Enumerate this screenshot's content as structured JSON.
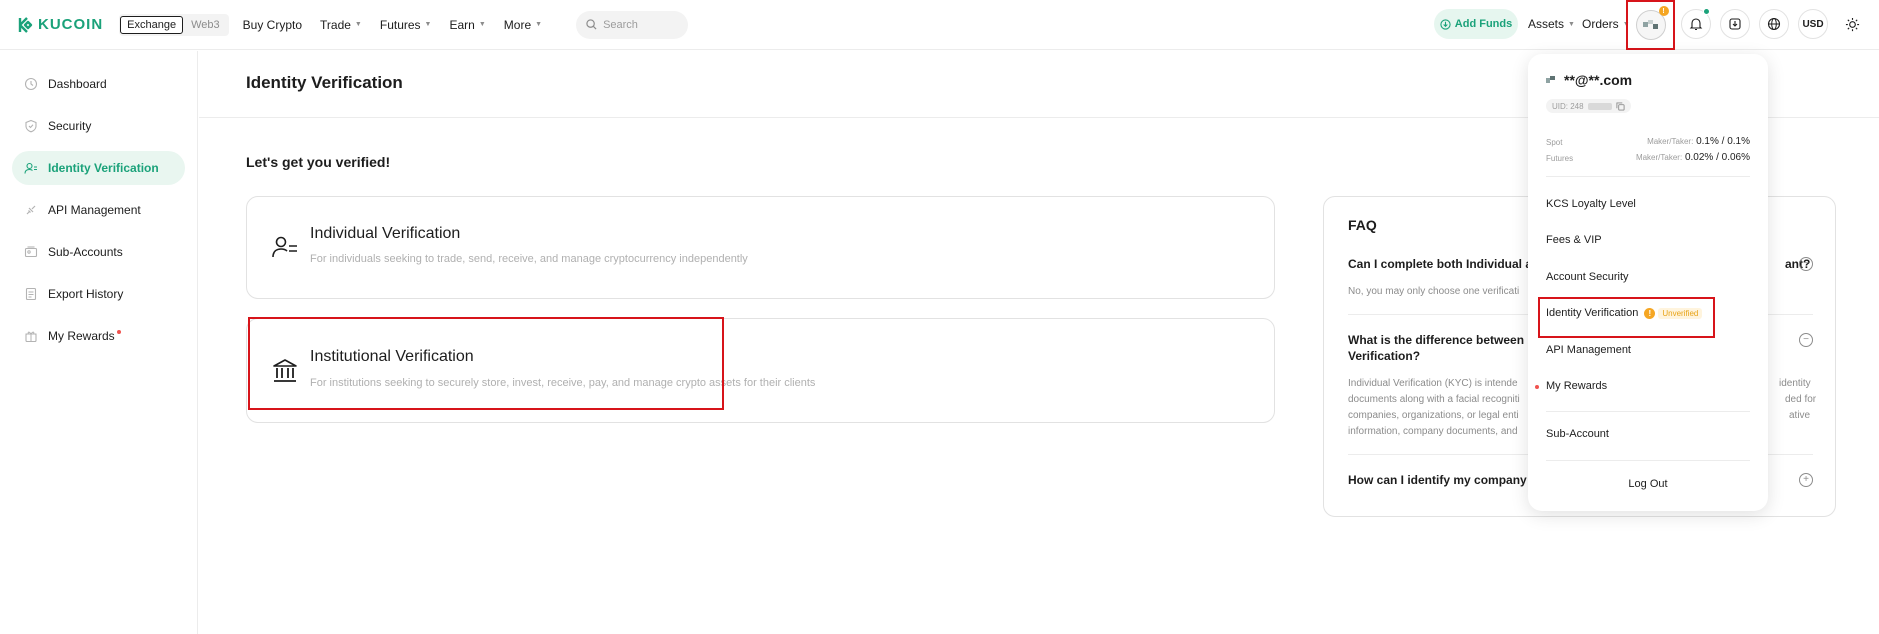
{
  "brand": {
    "name": "KUCOIN",
    "color": "#1ba27a"
  },
  "topbar": {
    "switch": {
      "exchange": "Exchange",
      "web3": "Web3"
    },
    "nav": [
      {
        "label": "Buy Crypto",
        "has_caret": false
      },
      {
        "label": "Trade",
        "has_caret": true
      },
      {
        "label": "Futures",
        "has_caret": true
      },
      {
        "label": "Earn",
        "has_caret": true
      },
      {
        "label": "More",
        "has_caret": true
      }
    ],
    "search_placeholder": "Search",
    "add_funds": "Add Funds",
    "assets": "Assets",
    "orders": "Orders",
    "avatar_badge": "!",
    "currency": "USD"
  },
  "sidebar": {
    "items": [
      {
        "label": "Dashboard",
        "icon": "clock-icon",
        "active": false
      },
      {
        "label": "Security",
        "icon": "shield-icon",
        "active": false
      },
      {
        "label": "Identity Verification",
        "icon": "user-check-icon",
        "active": true
      },
      {
        "label": "API Management",
        "icon": "api-icon",
        "active": false
      },
      {
        "label": "Sub-Accounts",
        "icon": "sub-accounts-icon",
        "active": false
      },
      {
        "label": "Export History",
        "icon": "export-icon",
        "active": false
      },
      {
        "label": "My Rewards",
        "icon": "gift-icon",
        "active": false
      }
    ]
  },
  "main": {
    "title": "Identity Verification",
    "subtitle": "Let's get you verified!",
    "cards": [
      {
        "title": "Individual Verification",
        "desc": "For individuals seeking to trade, send, receive, and manage cryptocurrency independently",
        "icon": "person-list-icon"
      },
      {
        "title": "Institutional Verification",
        "desc": "For institutions seeking to securely store, invest, receive, pay, and manage crypto assets for their clients",
        "icon": "bank-icon"
      }
    ]
  },
  "faq": {
    "title": "FAQ",
    "items": [
      {
        "q1": "Can I complete both Individual an",
        "q2": "ant?",
        "a": "No, you may only choose one verificati",
        "expanded": true
      },
      {
        "q1": "What is the difference between In",
        "q2": "Verification?",
        "a_left": [
          "Individual Verification (KYC) is intende",
          "documents along with a facial recogniti",
          "companies, organizations, or legal enti",
          "information, company documents, and"
        ],
        "a_right": [
          "identity",
          "ded for",
          "ative",
          ""
        ],
        "expanded": true
      },
      {
        "q1": "How can I identify my company ty",
        "expanded": false
      }
    ]
  },
  "dropdown": {
    "email": "**@**.com",
    "uid": "UID: 248",
    "fees": [
      {
        "label": "Spot",
        "maker_taker_label": "Maker/Taker:",
        "value": "0.1% / 0.1%"
      },
      {
        "label": "Futures",
        "maker_taker_label": "Maker/Taker:",
        "value": "0.02% / 0.06%"
      }
    ],
    "menu": [
      {
        "label": "KCS Loyalty Level"
      },
      {
        "label": "Fees & VIP"
      },
      {
        "label": "Account Security"
      },
      {
        "label": "Identity Verification",
        "status": "Unverified"
      },
      {
        "label": "API Management"
      },
      {
        "label": "My Rewards"
      },
      {
        "label": "Sub-Account"
      }
    ],
    "logout": "Log Out"
  }
}
